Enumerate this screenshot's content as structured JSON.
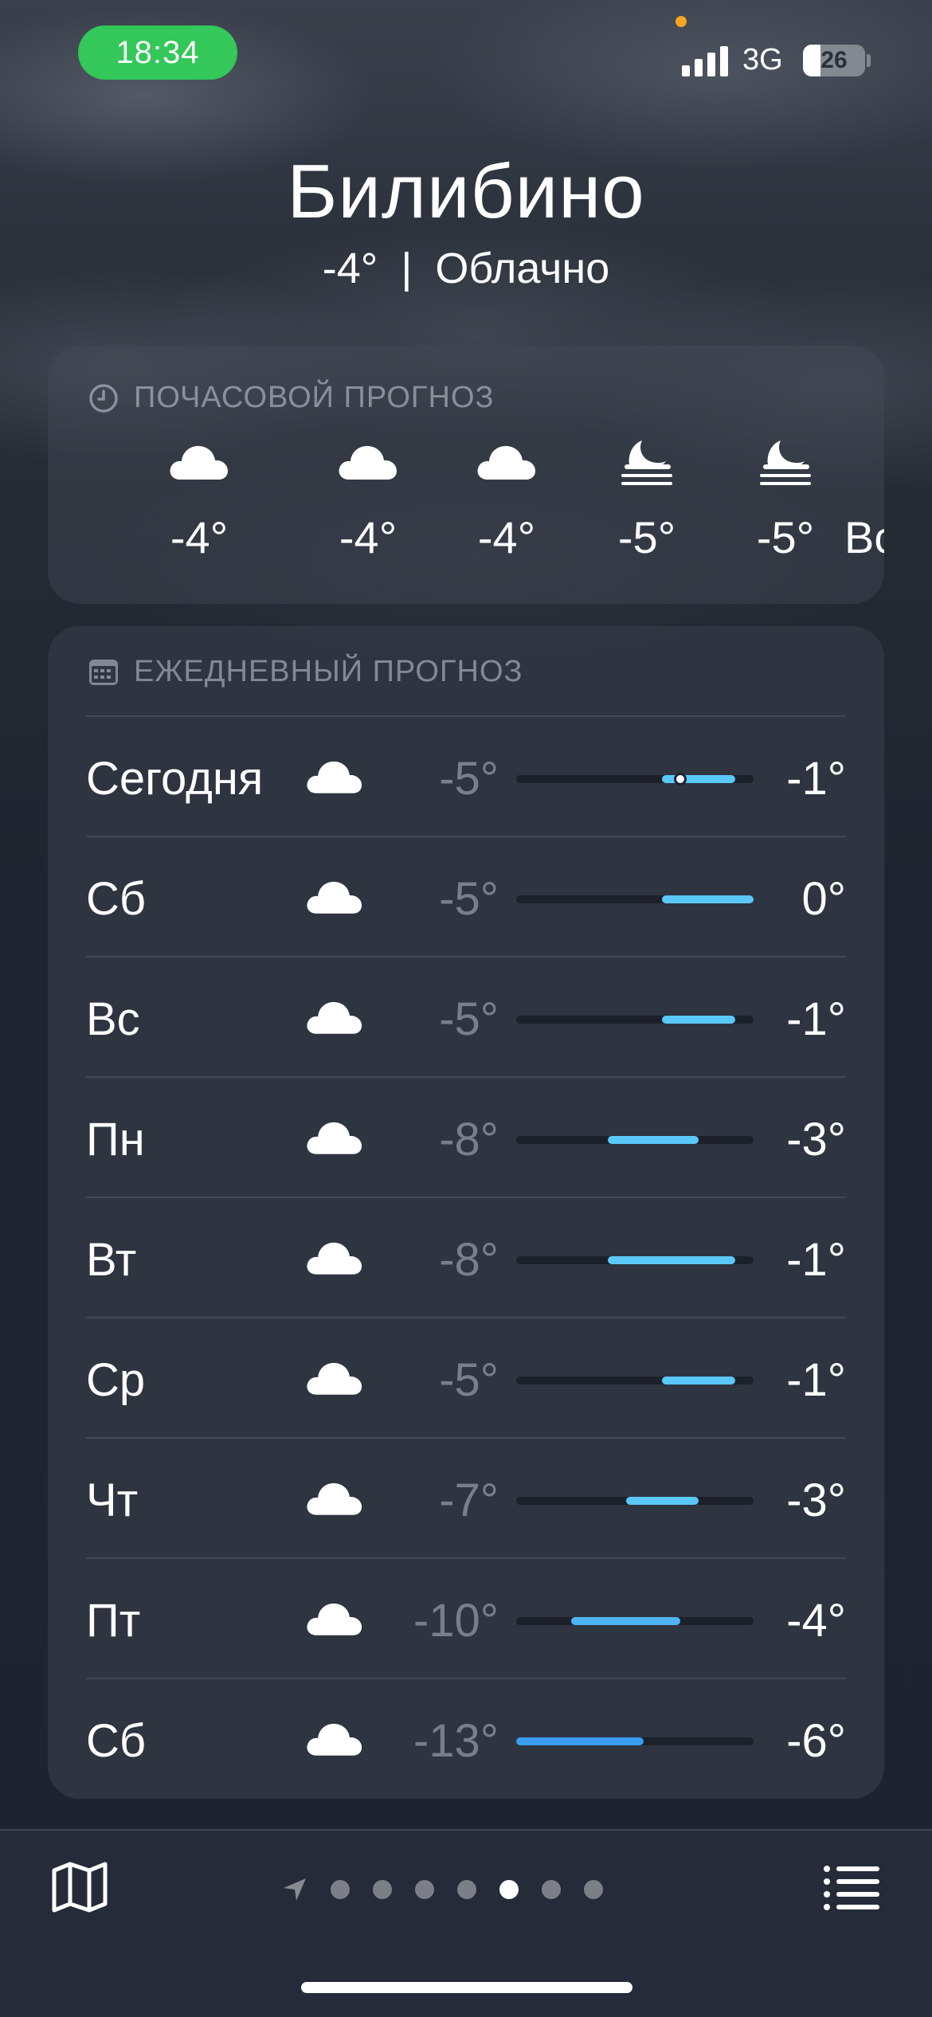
{
  "status_bar": {
    "time": "18:34",
    "network": "3G",
    "battery": "26"
  },
  "header": {
    "city": "Билибино",
    "current_temp": "-4°",
    "separator": "|",
    "condition": "Облачно"
  },
  "hourly": {
    "title": "ПОЧАСОВОЙ ПРОГНОЗ",
    "items": [
      {
        "icon": "cloud-icon",
        "temp": "-4°"
      },
      {
        "icon": "cloud-icon",
        "temp": "-4°"
      },
      {
        "icon": "cloud-icon",
        "temp": "-4°"
      },
      {
        "icon": "moon-fog-icon",
        "temp": "-5°"
      },
      {
        "icon": "moon-fog-icon",
        "temp": "-5°"
      },
      {
        "icon": "",
        "temp": "Вс"
      }
    ]
  },
  "daily": {
    "title": "ЕЖЕДНЕВНЫЙ ПРОГНОЗ",
    "range_min": -13,
    "range_max": 0,
    "days": [
      {
        "day": "Сегодня",
        "icon": "cloud-icon",
        "lo": "-5°",
        "hi": "-1°",
        "lo_val": -5,
        "hi_val": -1,
        "current_val": -4,
        "color": "#5ac8fa"
      },
      {
        "day": "Сб",
        "icon": "cloud-icon",
        "lo": "-5°",
        "hi": "0°",
        "lo_val": -5,
        "hi_val": 0,
        "color": "#5ac8fa"
      },
      {
        "day": "Вс",
        "icon": "cloud-icon",
        "lo": "-5°",
        "hi": "-1°",
        "lo_val": -5,
        "hi_val": -1,
        "color": "#5ac8fa"
      },
      {
        "day": "Пн",
        "icon": "cloud-icon",
        "lo": "-8°",
        "hi": "-3°",
        "lo_val": -8,
        "hi_val": -3,
        "color": "#5ac8fa"
      },
      {
        "day": "Вт",
        "icon": "cloud-icon",
        "lo": "-8°",
        "hi": "-1°",
        "lo_val": -8,
        "hi_val": -1,
        "color": "#5ac8fa"
      },
      {
        "day": "Ср",
        "icon": "cloud-icon",
        "lo": "-5°",
        "hi": "-1°",
        "lo_val": -5,
        "hi_val": -1,
        "color": "#5ac8fa"
      },
      {
        "day": "Чт",
        "icon": "cloud-icon",
        "lo": "-7°",
        "hi": "-3°",
        "lo_val": -7,
        "hi_val": -3,
        "color": "#5ac8fa"
      },
      {
        "day": "Пт",
        "icon": "cloud-icon",
        "lo": "-10°",
        "hi": "-4°",
        "lo_val": -10,
        "hi_val": -4,
        "color": "#4fb4f5"
      },
      {
        "day": "Сб",
        "icon": "cloud-icon",
        "lo": "-13°",
        "hi": "-6°",
        "lo_val": -13,
        "hi_val": -6,
        "color": "#3a9df0"
      }
    ]
  },
  "bottom_bar": {
    "map_icon": "map-icon",
    "location_icon": "location-arrow-icon",
    "list_icon": "list-icon",
    "page_count": 7,
    "active_page": 5
  },
  "colors": {
    "time_pill": "#34c759",
    "temp_bar": "#5ac8fa",
    "mic_indicator": "#f5a623"
  }
}
